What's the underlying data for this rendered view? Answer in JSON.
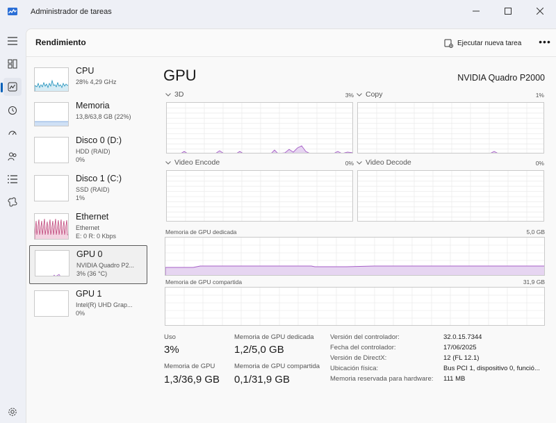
{
  "window": {
    "title": "Administrador de tareas"
  },
  "header": {
    "title": "Rendimiento",
    "run_task_label": "Ejecutar nueva tarea",
    "more_label": "•••"
  },
  "devices": [
    {
      "name": "CPU",
      "sub1": "28% 4,29 GHz",
      "sub2": "",
      "sub3": ""
    },
    {
      "name": "Memoria",
      "sub1": "13,8/63,8 GB (22%)",
      "sub2": "",
      "sub3": ""
    },
    {
      "name": "Disco 0 (D:)",
      "sub1": "HDD (RAID)",
      "sub2": "0%",
      "sub3": ""
    },
    {
      "name": "Disco 1 (C:)",
      "sub1": "SSD (RAID)",
      "sub2": "1%",
      "sub3": ""
    },
    {
      "name": "Ethernet",
      "sub1": "Ethernet",
      "sub2": "E: 0 R: 0 Kbps",
      "sub3": ""
    },
    {
      "name": "GPU 0",
      "sub1": "NVIDIA Quadro P2...",
      "sub2": "3% (36 °C)",
      "sub3": ""
    },
    {
      "name": "GPU 1",
      "sub1": "Intel(R) UHD Grap...",
      "sub2": "0%",
      "sub3": ""
    }
  ],
  "gpu": {
    "title": "GPU",
    "model": "NVIDIA Quadro P2000",
    "engines": [
      {
        "label": "3D",
        "percent": "3%"
      },
      {
        "label": "Copy",
        "percent": "1%"
      },
      {
        "label": "Video Encode",
        "percent": "0%"
      },
      {
        "label": "Video Decode",
        "percent": "0%"
      }
    ],
    "dedicated_memory": {
      "label": "Memoria de GPU dedicada",
      "max": "5,0 GB"
    },
    "shared_memory": {
      "label": "Memoria de GPU compartida",
      "max": "31,9 GB"
    }
  },
  "stats": {
    "usage_label": "Uso",
    "usage_value": "3%",
    "dedicated_label": "Memoria de GPU dedicada",
    "dedicated_value": "1,2/5,0 GB",
    "gpu_mem_label": "Memoria de GPU",
    "gpu_mem_value": "1,3/36,9 GB",
    "shared_label": "Memoria de GPU compartida",
    "shared_value": "0,1/31,9 GB"
  },
  "details": [
    {
      "key": "Versión del controlador:",
      "value": "32.0.15.7344"
    },
    {
      "key": "Fecha del controlador:",
      "value": "17/06/2025"
    },
    {
      "key": "Versión de DirectX:",
      "value": "12 (FL 12.1)"
    },
    {
      "key": "Ubicación física:",
      "value": "Bus PCI 1, dispositivo 0, funció..."
    },
    {
      "key": "Memoria reservada para hardware:",
      "value": "111 MB"
    }
  ],
  "colors": {
    "gpu_line": "#a65fc7",
    "gpu_fill": "#e6d5f1",
    "cpu_line": "#1a8fba",
    "mem_line": "#6b9bd6",
    "eth_line": "#b6306a",
    "accent": "#005fb8"
  },
  "icons": {
    "app": "task-manager-icon",
    "minimize": "minimize-icon",
    "maximize": "maximize-icon",
    "close": "close-icon",
    "menu": "hamburger-menu-icon",
    "processes": "processes-icon",
    "performance": "performance-icon",
    "history": "app-history-icon",
    "startup": "startup-apps-icon",
    "users": "users-icon",
    "details": "details-icon",
    "services": "services-icon",
    "settings": "settings-icon",
    "run_task": "run-new-task-icon"
  }
}
